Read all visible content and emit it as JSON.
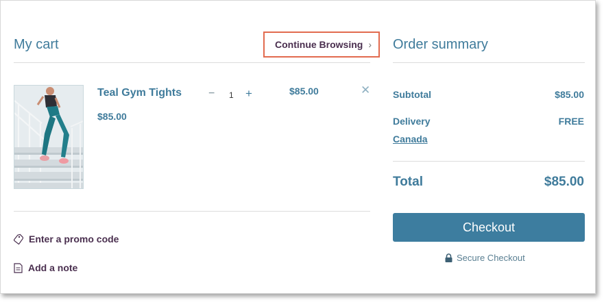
{
  "cart": {
    "title": "My cart",
    "continue_label": "Continue Browsing",
    "continue_chevron": "›"
  },
  "item": {
    "name": "Teal Gym Tights",
    "price": "$85.00",
    "quantity": "1",
    "minus": "−",
    "plus": "+",
    "line_total": "$85.00",
    "remove": "✕",
    "image_icon": "product-photo-woman-running-stairs"
  },
  "actions": {
    "promo_label": "Enter a promo code",
    "promo_icon": "tag-icon",
    "note_label": "Add a note",
    "note_icon": "note-icon"
  },
  "summary": {
    "title": "Order summary",
    "subtotal_label": "Subtotal",
    "subtotal_value": "$85.00",
    "delivery_label": "Delivery",
    "delivery_value": "FREE",
    "delivery_country": "Canada",
    "total_label": "Total",
    "total_value": "$85.00",
    "checkout_label": "Checkout",
    "secure_label": "Secure Checkout",
    "secure_icon": "lock-icon"
  },
  "colors": {
    "accent": "#3d7d9f",
    "heading_text": "#3f7b9b",
    "link_text": "#4a2f4f",
    "highlight_border": "#e26a4e"
  }
}
